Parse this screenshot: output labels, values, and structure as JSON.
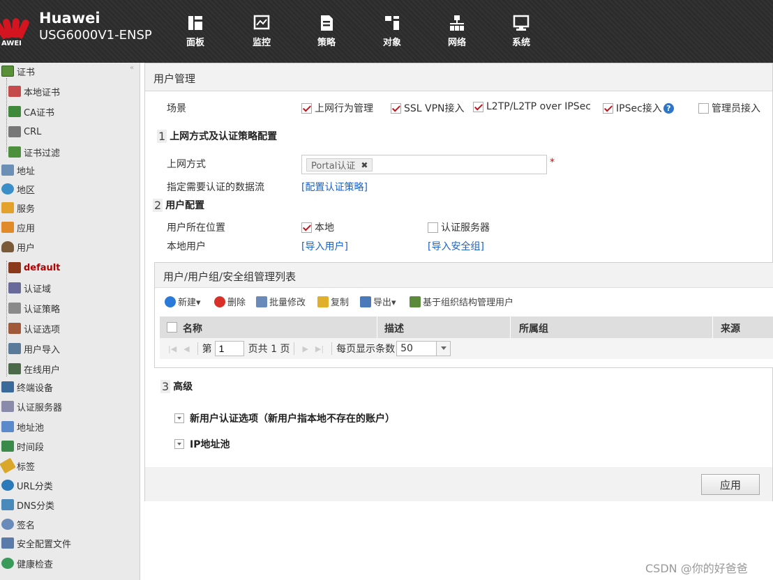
{
  "header": {
    "brand": "Huawei",
    "logo_text": "AWEI",
    "model": "USG6000V1-ENSP",
    "tabs": [
      {
        "label": "面板",
        "icon": "dashboard-icon"
      },
      {
        "label": "监控",
        "icon": "monitor-icon"
      },
      {
        "label": "策略",
        "icon": "policy-icon"
      },
      {
        "label": "对象",
        "icon": "object-icon",
        "active": true
      },
      {
        "label": "网络",
        "icon": "network-icon"
      },
      {
        "label": "系统",
        "icon": "system-icon"
      }
    ]
  },
  "sidebar": {
    "collapse": "«",
    "items": [
      {
        "label": "证书",
        "icon": "certificate-icon"
      },
      {
        "label": "本地证书",
        "icon": "local-certificate-icon"
      },
      {
        "label": "CA证书",
        "icon": "ca-certificate-icon"
      },
      {
        "label": "CRL",
        "icon": "crl-icon"
      },
      {
        "label": "证书过滤",
        "icon": "certificate-filter-icon"
      },
      {
        "label": "地址",
        "icon": "address-icon"
      },
      {
        "label": "地区",
        "icon": "region-icon"
      },
      {
        "label": "服务",
        "icon": "service-icon"
      },
      {
        "label": "应用",
        "icon": "application-icon"
      },
      {
        "label": "用户",
        "icon": "user-icon"
      },
      {
        "label": "default",
        "icon": "default-user-icon"
      },
      {
        "label": "认证域",
        "icon": "auth-domain-icon"
      },
      {
        "label": "认证策略",
        "icon": "auth-policy-icon"
      },
      {
        "label": "认证选项",
        "icon": "auth-option-icon"
      },
      {
        "label": "用户导入",
        "icon": "user-import-icon"
      },
      {
        "label": "在线用户",
        "icon": "online-user-icon"
      },
      {
        "label": "终端设备",
        "icon": "terminal-device-icon"
      },
      {
        "label": "认证服务器",
        "icon": "auth-server-icon"
      },
      {
        "label": "地址池",
        "icon": "address-pool-icon"
      },
      {
        "label": "时间段",
        "icon": "time-range-icon"
      },
      {
        "label": "标签",
        "icon": "tag-icon"
      },
      {
        "label": "URL分类",
        "icon": "url-category-icon"
      },
      {
        "label": "DNS分类",
        "icon": "dns-category-icon"
      },
      {
        "label": "签名",
        "icon": "signature-icon"
      },
      {
        "label": "安全配置文件",
        "icon": "security-profile-icon"
      },
      {
        "label": "健康检查",
        "icon": "health-check-icon"
      }
    ]
  },
  "panel": {
    "title": "用户管理",
    "scene_label": "场景",
    "scenes": [
      {
        "label": "上网行为管理",
        "checked": true
      },
      {
        "label": "SSL VPN接入",
        "checked": true
      },
      {
        "label": "L2TP/L2TP over IPSec",
        "checked": true
      },
      {
        "label": "IPSec接入",
        "checked": true
      },
      {
        "label": "管理员接入",
        "checked": false
      }
    ],
    "help": "?",
    "section1": {
      "num": "1",
      "title": "上网方式及认证策略配置"
    },
    "access_label": "上网方式",
    "access_tag": "Portal认证",
    "tag_remove": "✖",
    "required_mark": "*",
    "flow_label": "指定需要认证的数据流",
    "flow_link": "[配置认证策略]",
    "section2": {
      "num": "2",
      "title": "用户配置"
    },
    "location_label": "用户所在位置",
    "location_local": {
      "label": "本地",
      "checked": true
    },
    "location_server": {
      "label": "认证服务器",
      "checked": false
    },
    "local_user_label": "本地用户",
    "import_user_link": "[导入用户]",
    "import_group_link": "[导入安全组]",
    "list": {
      "title": "用户/用户组/安全组管理列表",
      "toolbar": {
        "new": "新建▾",
        "delete": "删除",
        "batch_edit": "批量修改",
        "copy": "复制",
        "export": "导出▾",
        "org_manage": "基于组织结构管理用户"
      },
      "columns": [
        "名称",
        "描述",
        "所属组",
        "来源"
      ],
      "pager": {
        "first": "|◀",
        "prev": "◀",
        "page_prefix": "第",
        "page_value": "1",
        "page_suffix": "页共 1 页",
        "next": "▶",
        "last": "▶|",
        "per_page_label": "每页显示条数",
        "per_page_value": "50"
      }
    },
    "section3": {
      "num": "3",
      "title": "高级"
    },
    "advanced_new_user": "新用户认证选项（新用户指本地不存在的账户）",
    "advanced_ip_pool": "IP地址池",
    "apply": "应用"
  },
  "watermark": "CSDN @你的好爸爸",
  "colors": {
    "accent_red": "#c2121b",
    "link_blue": "#1a62c6",
    "header_bg": "#2c2c2c"
  }
}
